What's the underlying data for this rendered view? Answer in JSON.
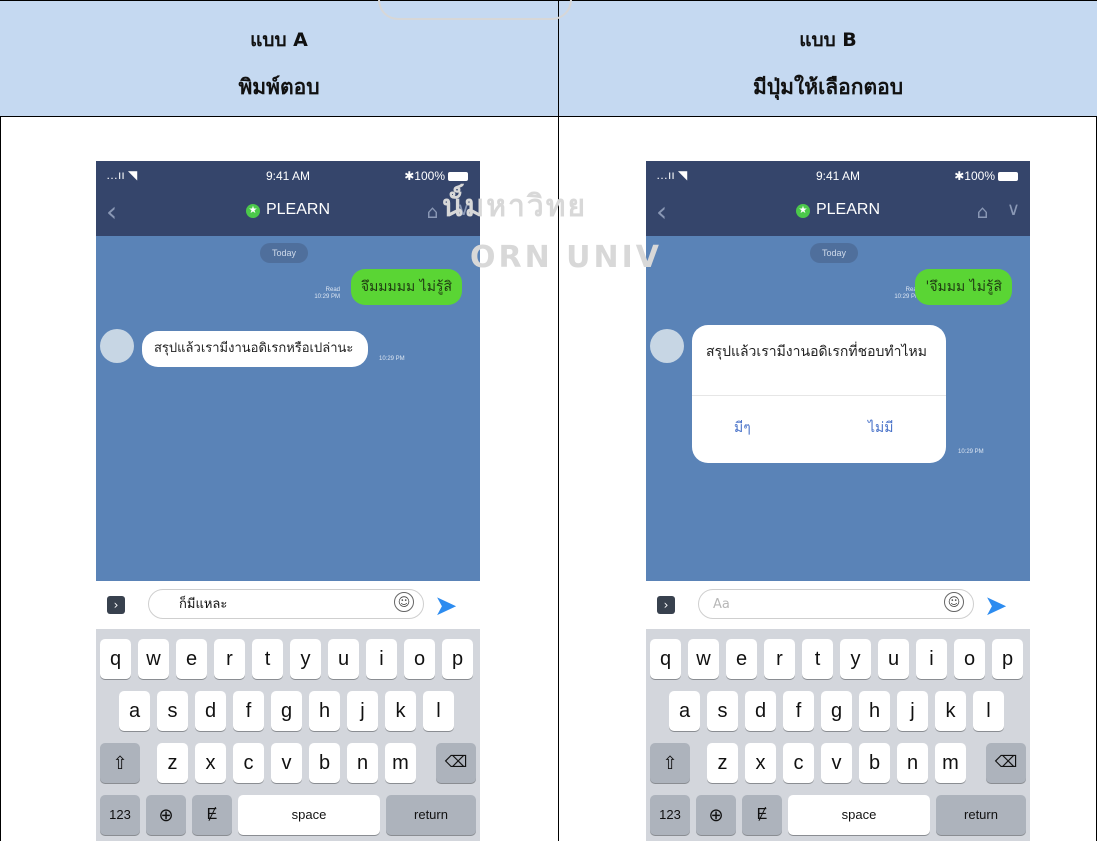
{
  "table": {
    "col_a": {
      "style": "แบบ A",
      "title": "พิมพ์ตอบ"
    },
    "col_b": {
      "style": "แบบ B",
      "title": "มีปุ่มให้เลือกตอบ"
    }
  },
  "watermark": {
    "line1": "นั์มหาวิทย",
    "line2": "ORN UNIV"
  },
  "phone": {
    "status": {
      "signal": "…ıı ◥",
      "time": "9:41 AM",
      "battery": "✱100%"
    },
    "nav": {
      "title": "PLEARN",
      "back_icon": "chevron-left-icon",
      "home_icon": "home-icon",
      "menu_icon": "chevron-down-icon"
    },
    "today": "Today",
    "read_label": "Read",
    "read_time": "10:29 PM",
    "msg_time": "10:29 PM"
  },
  "chat_a": {
    "sent": "จึมมมมม ไม่รู้สิ",
    "received": "สรุปแล้วเรามีงานอดิเรกหรือเปล่านะ",
    "input_value": "ก็มีแหละ"
  },
  "chat_b": {
    "sent": "'จึมมม ไม่รู้สิ",
    "received": "สรุปแล้วเรามีงานอดิเรกที่ชอบทำไหม",
    "option_yes": "มีๆ",
    "option_no": "ไม่มี",
    "input_placeholder": "Aa"
  },
  "keyboard": {
    "row1": [
      "q",
      "w",
      "e",
      "r",
      "t",
      "y",
      "u",
      "i",
      "o",
      "p"
    ],
    "row2": [
      "a",
      "s",
      "d",
      "f",
      "g",
      "h",
      "j",
      "k",
      "l"
    ],
    "row3": [
      "z",
      "x",
      "c",
      "v",
      "b",
      "n",
      "m"
    ],
    "shift": "⇧",
    "delete": "⌫",
    "numbers": "123",
    "globe": "⊕",
    "mic": "Ɇ",
    "space": "space",
    "return": "return"
  }
}
